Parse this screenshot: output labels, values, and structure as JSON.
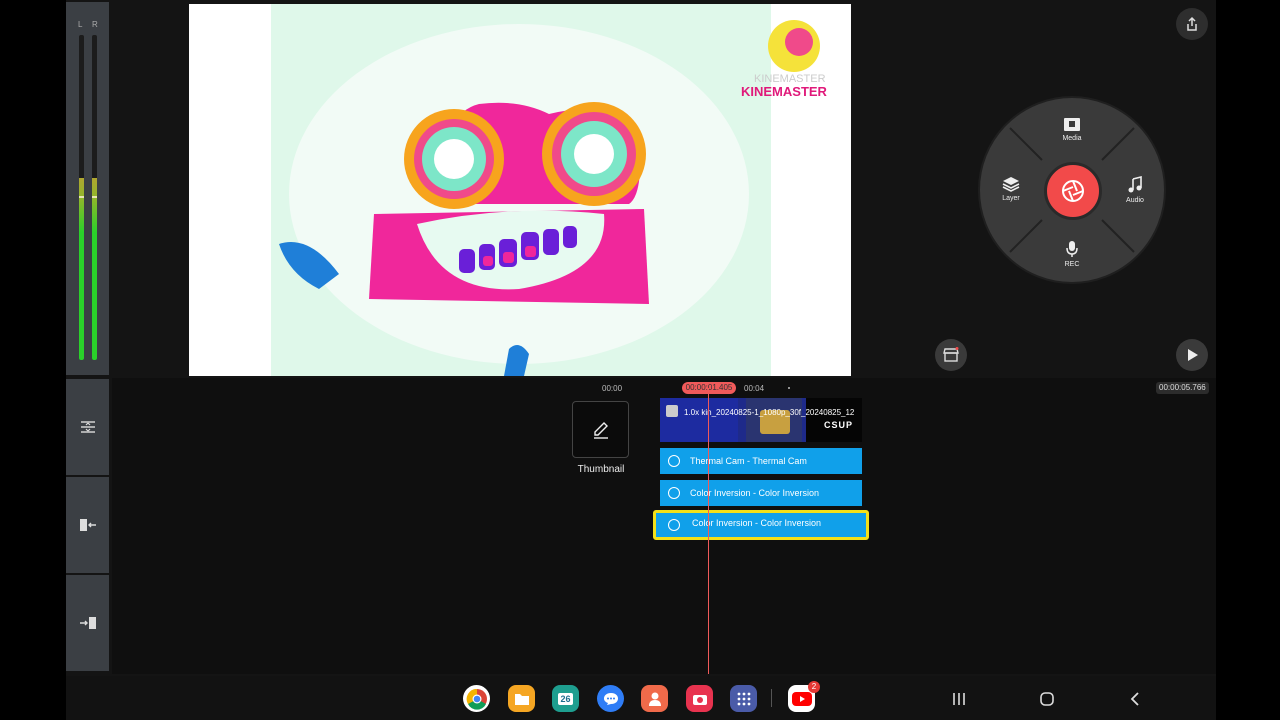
{
  "meters": {
    "left_label": "L",
    "right_label": "R",
    "left_level": 0.56,
    "right_level": 0.56
  },
  "preview": {
    "watermark_text_1": "KINEMASTER",
    "watermark_text_2": "KINEMASTER"
  },
  "wheel": {
    "media_label": "Media",
    "layer_label": "Layer",
    "audio_label": "Audio",
    "rec_label": "REC"
  },
  "timeline": {
    "ruler": {
      "start": "00:00",
      "mark": "00:04"
    },
    "current_time": "00:00:01.405",
    "total_time": "00:00:05.766",
    "thumbnail_label": "Thumbnail",
    "main_clip_title": "1.0x kin_20240825-1_1080p_30f_20240825_12",
    "clip_thumb_text": "CSUP",
    "effects": [
      {
        "label": "Thermal Cam - Thermal Cam"
      },
      {
        "label": "Color Inversion - Color Inversion"
      },
      {
        "label": "Color Inversion - Color Inversion"
      }
    ]
  },
  "taskbar": {
    "calendar_day": "26",
    "youtube_badge": "2"
  },
  "colors": {
    "accent_red": "#f24a4a",
    "clip_blue": "#10a0ea",
    "selection_yellow": "#f2e019"
  },
  "icons": [
    "share-icon",
    "media-icon",
    "layer-icon",
    "audio-icon",
    "mic-icon",
    "camera-shutter-icon",
    "store-icon",
    "play-icon",
    "pencil-icon",
    "split-icon",
    "trim-left-icon",
    "trim-right-icon"
  ]
}
